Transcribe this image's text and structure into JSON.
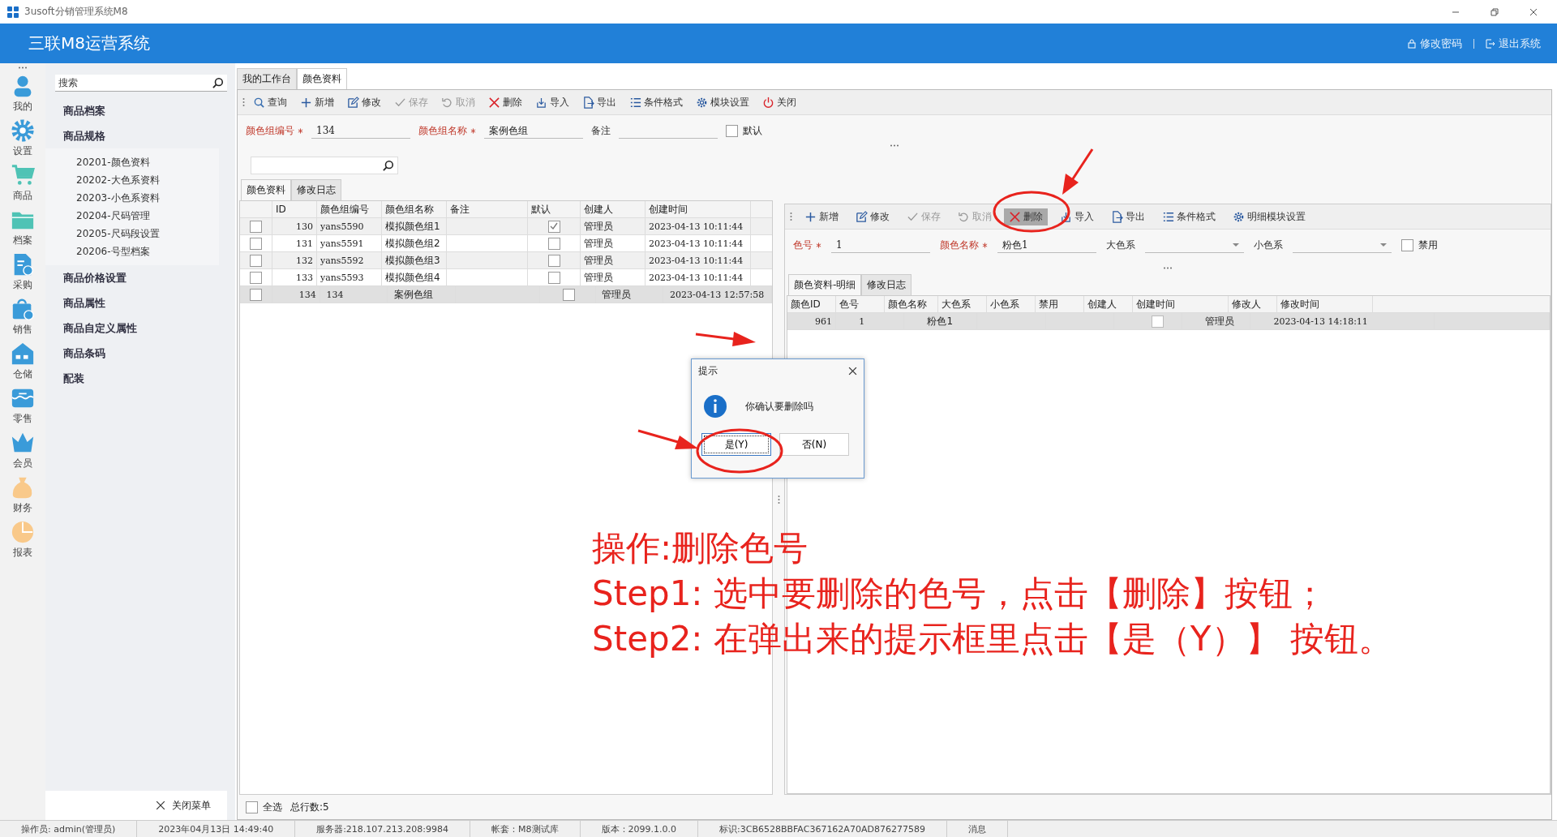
{
  "window": {
    "title": "3usoft分销管理系统M8"
  },
  "header": {
    "title": "三联M8运营系统",
    "actions": [
      {
        "label": "修改密码",
        "kind": "lock"
      },
      {
        "label": "退出系统",
        "kind": "exit"
      }
    ]
  },
  "nav_rail": [
    {
      "label": "我的",
      "kind": "user"
    },
    {
      "label": "设置",
      "kind": "gear"
    },
    {
      "label": "商品",
      "kind": "cart"
    },
    {
      "label": "档案",
      "kind": "folder"
    },
    {
      "label": "采购",
      "kind": "doc"
    },
    {
      "label": "销售",
      "kind": "bag"
    },
    {
      "label": "仓储",
      "kind": "house"
    },
    {
      "label": "零售",
      "kind": "shop"
    },
    {
      "label": "会员",
      "kind": "crown"
    },
    {
      "label": "财务",
      "kind": "money"
    },
    {
      "label": "报表",
      "kind": "pie"
    }
  ],
  "menu": {
    "search_placeholder": "搜索",
    "items": [
      {
        "label": "商品档案"
      },
      {
        "label": "商品规格",
        "children": [
          {
            "label": "20201-颜色资料"
          },
          {
            "label": "20202-大色系资料"
          },
          {
            "label": "20203-小色系资料"
          },
          {
            "label": "20204-尺码管理"
          },
          {
            "label": "20205-尺码段设置"
          },
          {
            "label": "20206-号型档案"
          }
        ]
      },
      {
        "label": "商品价格设置"
      },
      {
        "label": "商品属性"
      },
      {
        "label": "商品自定义属性"
      },
      {
        "label": "商品条码"
      },
      {
        "label": "配装"
      }
    ],
    "close_label": "关闭菜单"
  },
  "tabs": [
    {
      "label": "我的工作台",
      "selected": false
    },
    {
      "label": "颜色资料",
      "selected": true
    }
  ],
  "toolbar": [
    {
      "label": "查询",
      "kind": "search",
      "disabled": false
    },
    {
      "label": "新增",
      "kind": "plus",
      "disabled": false
    },
    {
      "label": "修改",
      "kind": "edit",
      "disabled": false
    },
    {
      "label": "保存",
      "kind": "check",
      "disabled": true
    },
    {
      "label": "取消",
      "kind": "undo",
      "disabled": true
    },
    {
      "label": "删除",
      "kind": "delete",
      "disabled": false
    },
    {
      "label": "导入",
      "kind": "import",
      "disabled": false
    },
    {
      "label": "导出",
      "kind": "export",
      "disabled": false
    },
    {
      "label": "条件格式",
      "kind": "list",
      "disabled": false
    },
    {
      "label": "模块设置",
      "kind": "gear",
      "disabled": false
    },
    {
      "label": "关闭",
      "kind": "power",
      "disabled": false
    }
  ],
  "form": [
    {
      "label": "颜色组编号",
      "required": true,
      "value": "134",
      "kind": "text"
    },
    {
      "label": "颜色组名称",
      "required": true,
      "value": "案例色组",
      "kind": "text"
    },
    {
      "label": "备注",
      "required": false,
      "kind": "text"
    },
    {
      "label": "默认",
      "checked": false,
      "kind": "checkbox"
    }
  ],
  "grid_tabs": [
    {
      "label": "颜色资料",
      "selected": true
    },
    {
      "label": "修改日志",
      "selected": false
    }
  ],
  "table": {
    "columns": [
      "ID",
      "颜色组编号",
      "颜色组名称",
      "备注",
      "默认",
      "创建人",
      "创建时间"
    ],
    "rows": [
      {
        "selected": false,
        "checked": false,
        "id": "130",
        "code": "yans5590",
        "name": "模拟颜色组1",
        "default": true,
        "creator": "管理员",
        "created": "2023-04-13 10:11:44"
      },
      {
        "selected": false,
        "checked": false,
        "id": "131",
        "code": "yans5591",
        "name": "模拟颜色组2",
        "default": false,
        "creator": "管理员",
        "created": "2023-04-13 10:11:44"
      },
      {
        "selected": false,
        "checked": false,
        "id": "132",
        "code": "yans5592",
        "name": "模拟颜色组3",
        "default": false,
        "creator": "管理员",
        "created": "2023-04-13 10:11:44"
      },
      {
        "selected": false,
        "checked": false,
        "id": "133",
        "code": "yans5593",
        "name": "模拟颜色组4",
        "default": false,
        "creator": "管理员",
        "created": "2023-04-13 10:11:44"
      },
      {
        "selected": true,
        "checked": false,
        "id": "134",
        "code": "134",
        "name": "案例色组",
        "default": false,
        "creator": "管理员",
        "created": "2023-04-13 12:57:58"
      }
    ]
  },
  "table_footer": {
    "select_all": {
      "label": "全选",
      "checked": false
    },
    "total": "总行数:5"
  },
  "detail": {
    "toolbar": [
      {
        "label": "新增",
        "kind": "plus",
        "disabled": false,
        "selected": false
      },
      {
        "label": "修改",
        "kind": "edit",
        "disabled": false,
        "selected": false
      },
      {
        "label": "保存",
        "kind": "check",
        "disabled": true,
        "selected": false
      },
      {
        "label": "取消",
        "kind": "undo",
        "disabled": true,
        "selected": false
      },
      {
        "label": "删除",
        "kind": "delete",
        "disabled": false,
        "selected": true
      },
      {
        "label": "导入",
        "kind": "import",
        "disabled": false,
        "selected": false
      },
      {
        "label": "导出",
        "kind": "export",
        "disabled": false,
        "selected": false
      },
      {
        "label": "条件格式",
        "kind": "list",
        "disabled": false,
        "selected": false
      },
      {
        "label": "明细模块设置",
        "kind": "gear",
        "disabled": false,
        "selected": false
      }
    ],
    "form": [
      {
        "label": "色号",
        "required": true,
        "value": "1",
        "kind": "text"
      },
      {
        "label": "颜色名称",
        "required": true,
        "value": "粉色1",
        "kind": "text"
      },
      {
        "label": "大色系",
        "required": false,
        "kind": "select"
      },
      {
        "label": "小色系",
        "required": false,
        "kind": "select"
      },
      {
        "label": "禁用",
        "checked": false,
        "kind": "checkbox"
      }
    ],
    "tabs": [
      {
        "label": "颜色资料-明细",
        "selected": true
      },
      {
        "label": "修改日志",
        "selected": false
      }
    ],
    "table": {
      "columns": [
        "颜色ID",
        "色号",
        "颜色名称",
        "大色系",
        "小色系",
        "禁用",
        "创建人",
        "创建时间",
        "修改人",
        "修改时间"
      ],
      "rows": [
        {
          "selected": true,
          "id": "961",
          "code": "1",
          "name": "粉色1",
          "disabled": false,
          "creator": "管理员",
          "created": "2023-04-13 14:18:11"
        }
      ]
    }
  },
  "dialog": {
    "title": "提示",
    "message": "你确认要删除吗",
    "buttons": [
      {
        "label": "是(Y)",
        "selected": true
      },
      {
        "label": "否(N)",
        "selected": false
      }
    ]
  },
  "annotation": {
    "lines": [
      "操作:删除色号",
      "Step1: 选中要删除的色号，点击【删除】按钮；",
      "Step2: 在弹出来的提示框里点击【是（Y）】 按钮。"
    ]
  },
  "status_bar": [
    "操作员: admin(管理员)",
    "2023年04月13日 14:49:40",
    "服务器:218.107.213.208:9984",
    "帐套：M8测试库",
    "版本：2099.1.0.0",
    "标识:3CB6528BBFAC367162A70AD876277589",
    "消息"
  ]
}
